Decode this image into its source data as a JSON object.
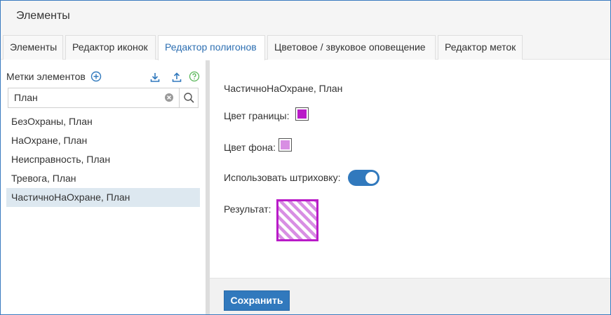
{
  "window": {
    "title": "Элементы"
  },
  "tabs": [
    {
      "label": "Элементы",
      "active": false
    },
    {
      "label": "Редактор иконок",
      "active": false
    },
    {
      "label": "Редактор полигонов",
      "active": true
    },
    {
      "label": "Цветовое / звуковое оповещение",
      "active": false
    },
    {
      "label": "Редактор меток",
      "active": false
    }
  ],
  "sidebar": {
    "header_label": "Метки элементов",
    "icons": [
      "add-circle-icon",
      "download-icon",
      "upload-icon",
      "help-icon"
    ],
    "search": {
      "value": "План",
      "clear_icon": "clear-icon",
      "search_icon": "search-icon"
    },
    "items": [
      {
        "label": "БезОхраны, План",
        "selected": false
      },
      {
        "label": "НаОхране, План",
        "selected": false
      },
      {
        "label": "Неисправность, План",
        "selected": false
      },
      {
        "label": "Тревога, План",
        "selected": false
      },
      {
        "label": "ЧастичноНаОхране, План",
        "selected": true
      }
    ]
  },
  "editor": {
    "title": "ЧастичноНаОхране, План",
    "border_color_label": "Цвет границы",
    "border_color": "#b91bc8",
    "fill_color_label": "Цвет фона",
    "fill_color": "#d88ee3",
    "hatch_label": "Использовать штриховку",
    "hatch_enabled": true,
    "result_label": "Результат"
  },
  "footer": {
    "save_label": "Сохранить"
  },
  "colors": {
    "accent": "#3179bd",
    "selected_row": "#dde8f0",
    "help": "#5cb85c"
  }
}
